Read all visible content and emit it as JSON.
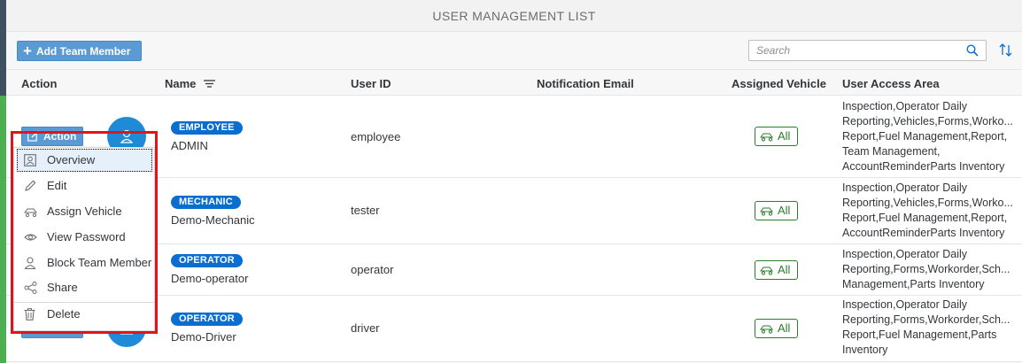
{
  "title": "USER MANAGEMENT LIST",
  "toolbar": {
    "add_label": "Add Team Member",
    "search_placeholder": "Search"
  },
  "columns": {
    "action": "Action",
    "name": "Name",
    "user_id": "User ID",
    "email": "Notification Email",
    "vehicle": "Assigned Vehicle",
    "access": "User Access Area"
  },
  "action_label": "Action",
  "rows": [
    {
      "role": "EMPLOYEE",
      "name": "ADMIN",
      "user_id": "employee",
      "email": "",
      "vehicle": "All",
      "access": "Inspection,Operator Daily\nReporting,Vehicles,Forms,Worko...\nReport,Fuel Management,Report,\nTeam Management,\nAccountReminderParts Inventory"
    },
    {
      "role": "MECHANIC",
      "name": "Demo-Mechanic",
      "user_id": "tester",
      "email": "",
      "vehicle": "All",
      "access": "Inspection,Operator Daily\nReporting,Vehicles,Forms,Worko...\nReport,Fuel Management,Report,\nAccountReminderParts Inventory"
    },
    {
      "role": "OPERATOR",
      "name": "Demo-operator",
      "user_id": "operator",
      "email": "",
      "vehicle": "All",
      "access": "Inspection,Operator Daily\nReporting,Forms,Workorder,Sch...\nManagement,Parts Inventory"
    },
    {
      "role": "OPERATOR",
      "name": "Demo-Driver",
      "user_id": "driver",
      "email": "",
      "vehicle": "All",
      "access": "Inspection,Operator Daily\nReporting,Forms,Workorder,Sch...\nReport,Fuel Management,Parts\nInventory"
    }
  ],
  "menu": {
    "items": [
      "Overview",
      "Edit",
      "Assign Vehicle",
      "View Password",
      "Block Team Member",
      "Share",
      "Delete"
    ],
    "focused": "Overview"
  },
  "colors": {
    "accent": "#0a6ed1",
    "button": "#5b9bd5",
    "vehicle_green": "#2b7d2b",
    "highlight_red": "#e0141b"
  }
}
